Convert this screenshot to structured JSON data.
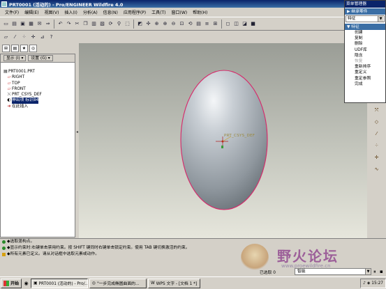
{
  "window": {
    "title": "PRT0001 (活动的) - Pro/ENGINEER Wildfire 4.0"
  },
  "menubar": [
    "文件(F)",
    "编辑(E)",
    "视图(V)",
    "插入(I)",
    "分析(A)",
    "信息(N)",
    "应用程序(P)",
    "工具(T)",
    "窗口(W)",
    "帮助(H)"
  ],
  "menu_manager": {
    "title": "菜单管理器",
    "header1": "▶ 继承零件",
    "selected": "特征",
    "header2": "▼ 特征",
    "items": [
      {
        "label": "创建",
        "enabled": true
      },
      {
        "label": "复制",
        "enabled": true
      },
      {
        "label": "删除",
        "enabled": true
      },
      {
        "label": "UDF库",
        "enabled": true
      },
      {
        "label": "隐含",
        "enabled": true
      },
      {
        "label": "恢复",
        "enabled": false
      },
      {
        "label": "重新排序",
        "enabled": true
      },
      {
        "label": "重定义",
        "enabled": true
      },
      {
        "label": "重定参照",
        "enabled": true
      },
      {
        "label": "完成",
        "enabled": true
      }
    ]
  },
  "nav": {
    "show_label": "显示 (I) ▾",
    "settings_label": "设置 (G) ▾",
    "tree": [
      {
        "label": "PRT0001.PRT",
        "icon": "part-icon",
        "level": 0,
        "selected": false
      },
      {
        "label": "RIGHT",
        "icon": "datum-plane-icon",
        "level": 1,
        "selected": false
      },
      {
        "label": "TOP",
        "icon": "datum-plane-icon",
        "level": 1,
        "selected": false
      },
      {
        "label": "FRONT",
        "icon": "datum-plane-icon",
        "level": 1,
        "selected": false
      },
      {
        "label": "PRT_CSYS_DEF",
        "icon": "csys-icon",
        "level": 1,
        "selected": false
      },
      {
        "label": "伸出项 标识84",
        "icon": "protrusion-icon",
        "level": 1,
        "selected": true
      },
      {
        "label": "在此插入",
        "icon": "insert-here-icon",
        "level": 1,
        "selected": false
      }
    ]
  },
  "viewport": {
    "csys_label": "PRT_CSYS_DEF"
  },
  "messages": [
    {
      "type": "info",
      "text": "◆选取混构点。"
    },
    {
      "type": "info",
      "text": "◆显示约束时:右键单击禁用约束。按 SHIFT 键同时右键单击锁定约束。使用 TAB 键切换激活的约束。"
    },
    {
      "type": "warn",
      "text": "◆所有元素已定义。请从对话框中选取元素或动作。"
    }
  ],
  "watermark": {
    "title": "野火论坛",
    "url": "www.proewildfire.cn"
  },
  "status": {
    "selected_label": "已选取 0",
    "filter_value": "智能"
  },
  "taskbar": {
    "start": "开始",
    "tasks": [
      {
        "label": "PRT0001 (活动的) - Pro/...",
        "active": true
      },
      {
        "label": "\"一步完成椭圆曲面的...",
        "active": false
      },
      {
        "label": "WPS 文字 - [文档 1 *]",
        "active": false
      }
    ],
    "clock": "15:27"
  }
}
